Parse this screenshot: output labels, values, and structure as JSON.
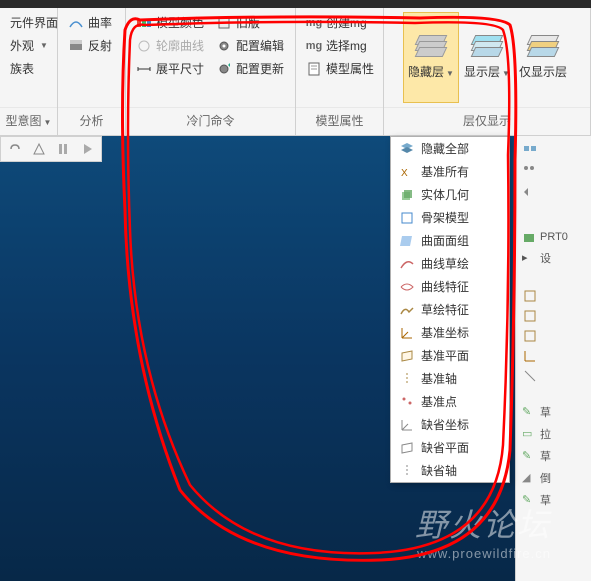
{
  "ribbon": {
    "group_left": {
      "items": [
        "元件界面",
        "外观",
        "族表",
        "型意图"
      ],
      "label": ""
    },
    "group_analysis": {
      "items": [
        "曲率",
        "反射"
      ],
      "label": "分析"
    },
    "group_cold": {
      "col1": [
        {
          "label": "模型颜色",
          "icon": "palette-icon"
        },
        {
          "label": "轮廓曲线",
          "icon": "curve-icon",
          "disabled": true
        },
        {
          "label": "展平尺寸",
          "icon": "dimension-icon"
        }
      ],
      "col2": [
        {
          "label": "旧版",
          "icon": "legacy-icon"
        },
        {
          "label": "配置编辑",
          "icon": "gear-icon"
        },
        {
          "label": "配置更新",
          "icon": "gear-refresh-icon"
        }
      ],
      "label": "冷门命令"
    },
    "group_model": {
      "items": [
        {
          "label": "创建mg",
          "icon": "mg-icon"
        },
        {
          "label": "选择mg",
          "icon": "mg-select-icon"
        },
        {
          "label": "模型属性",
          "icon": "props-icon"
        }
      ],
      "label": "模型属性"
    },
    "group_layers": {
      "hide": "隐藏层",
      "show": "显示层",
      "only": "仅显示层",
      "label": "层仅显示"
    }
  },
  "dropdown": {
    "items": [
      {
        "label": "隐藏全部",
        "icon": "layers-icon"
      },
      {
        "label": "基准所有",
        "icon": "datum-icon"
      },
      {
        "label": "实体几何",
        "icon": "solid-icon"
      },
      {
        "label": "骨架模型",
        "icon": "skeleton-icon"
      },
      {
        "label": "曲面面组",
        "icon": "surface-icon"
      },
      {
        "label": "曲线草绘",
        "icon": "sketch-curve-icon"
      },
      {
        "label": "曲线特征",
        "icon": "curve-feat-icon"
      },
      {
        "label": "草绘特征",
        "icon": "sketch-feat-icon"
      },
      {
        "label": "基准坐标",
        "icon": "csys-icon"
      },
      {
        "label": "基准平面",
        "icon": "plane-icon"
      },
      {
        "label": "基准轴",
        "icon": "axis-icon"
      },
      {
        "label": "基准点",
        "icon": "point-icon"
      },
      {
        "label": "缺省坐标",
        "icon": "def-csys-icon"
      },
      {
        "label": "缺省平面",
        "icon": "def-plane-icon"
      },
      {
        "label": "缺省轴",
        "icon": "def-axis-icon"
      }
    ]
  },
  "right_panel": {
    "items": [
      "PRT0",
      "设",
      "草",
      "拉",
      "草",
      "倒",
      "草"
    ]
  },
  "watermark": {
    "title": "野火论坛",
    "url": "www.proewildfire.cn"
  }
}
